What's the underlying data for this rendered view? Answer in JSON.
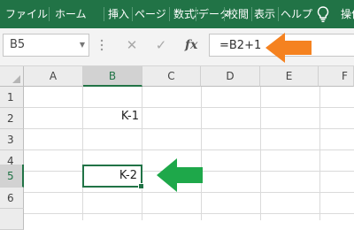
{
  "ribbon": {
    "tabs": [
      "ファイル",
      "ホーム",
      "挿入",
      "ページ レイアウト",
      "数式",
      "データ",
      "校閲",
      "表示",
      "ヘルプ"
    ],
    "search_label": "操作"
  },
  "formula_bar": {
    "name_box": "B5",
    "cancel_symbol": "✕",
    "enter_symbol": "✓",
    "fx_symbol": "fx",
    "formula": "=B2+1"
  },
  "grid": {
    "columns": [
      "A",
      "B",
      "C",
      "D",
      "E",
      "F"
    ],
    "rows": [
      "1",
      "2",
      "3",
      "4",
      "5",
      "6"
    ],
    "active_column": "B",
    "active_row": "5",
    "cells": {
      "B2": "K-1",
      "B5": "K-2"
    }
  },
  "annotations": {
    "formula_arrow_color": "#f58220",
    "cell_arrow_color": "#1ea84a"
  },
  "colors": {
    "excel_green": "#217346"
  }
}
